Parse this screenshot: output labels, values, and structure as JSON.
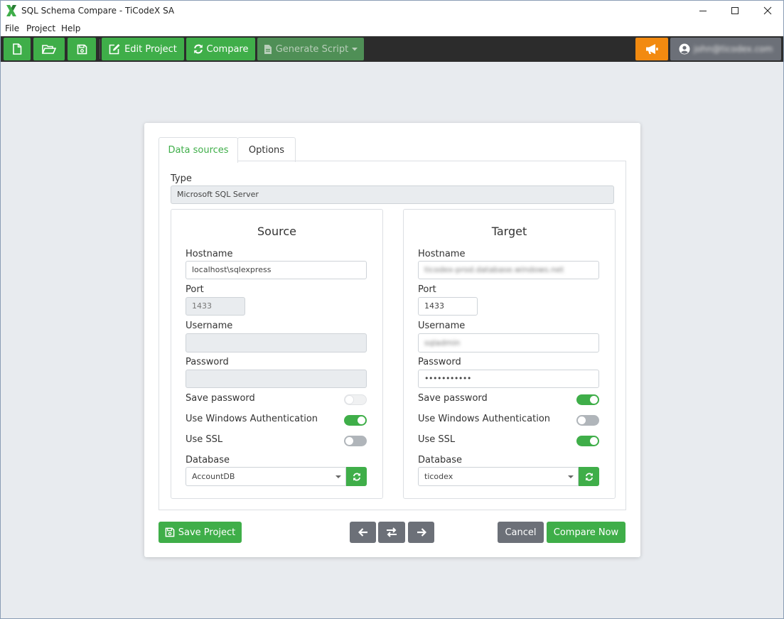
{
  "window": {
    "title": "SQL Schema Compare - TiCodeX SA",
    "controls": [
      "minimize-icon",
      "maximize-icon",
      "close-icon"
    ]
  },
  "menu": {
    "items": [
      "File",
      "Project",
      "Help"
    ]
  },
  "toolbar": {
    "new_icon": "file-icon",
    "open_icon": "folder-open-icon",
    "save_icon": "save-icon",
    "edit_project_label": "Edit Project",
    "compare_label": "Compare",
    "generate_script_label": "Generate Script",
    "announce_icon": "megaphone-icon",
    "account_email": "john@ticodex.com"
  },
  "tabs": [
    {
      "label": "Data sources",
      "active": true
    },
    {
      "label": "Options",
      "active": false
    }
  ],
  "type": {
    "label": "Type",
    "value": "Microsoft SQL Server"
  },
  "source": {
    "title": "Source",
    "hostname_label": "Hostname",
    "hostname": "localhost\\sqlexpress",
    "port_label": "Port",
    "port": "1433",
    "username_label": "Username",
    "username": "",
    "password_label": "Password",
    "password": "",
    "save_password_label": "Save password",
    "save_password": false,
    "windows_auth_label": "Use Windows Authentication",
    "windows_auth": true,
    "ssl_label": "Use SSL",
    "ssl": false,
    "database_label": "Database",
    "database": "AccountDB"
  },
  "target": {
    "title": "Target",
    "hostname_label": "Hostname",
    "hostname": "ticodex-prod.database.windows.net",
    "port_label": "Port",
    "port": "1433",
    "username_label": "Username",
    "username": "sqladmin",
    "password_label": "Password",
    "password": "•••••••••••",
    "save_password_label": "Save password",
    "save_password": true,
    "windows_auth_label": "Use Windows Authentication",
    "windows_auth": false,
    "ssl_label": "Use SSL",
    "ssl": true,
    "database_label": "Database",
    "database": "ticodex"
  },
  "footer": {
    "save_project_label": "Save Project",
    "cancel_label": "Cancel",
    "compare_now_label": "Compare Now"
  },
  "colors": {
    "accent": "#3fae49",
    "toolbar_bg": "#2c2c2c",
    "notify": "#f28a10",
    "neutral_button": "#6c7078"
  }
}
